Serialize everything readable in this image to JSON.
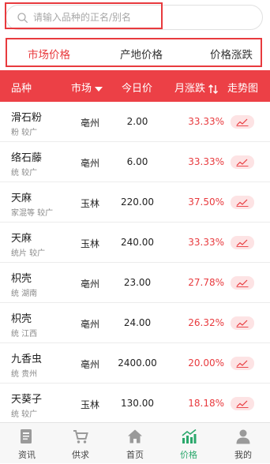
{
  "search": {
    "placeholder": "请输入品种的正名/别名"
  },
  "tabs": [
    {
      "label": "市场价格",
      "active": true
    },
    {
      "label": "产地价格",
      "active": false
    },
    {
      "label": "价格涨跌",
      "active": false
    }
  ],
  "table": {
    "headers": {
      "variety": "品种",
      "market": "市场",
      "price": "今日价",
      "change": "月涨跌",
      "trend": "走势图"
    },
    "rows": [
      {
        "name": "滑石粉",
        "spec": "粉 较广",
        "market": "亳州",
        "price": "2.00",
        "change": "33.33%"
      },
      {
        "name": "络石藤",
        "spec": "统 较广",
        "market": "亳州",
        "price": "6.00",
        "change": "33.33%"
      },
      {
        "name": "天麻",
        "spec": "家混等 较广",
        "market": "玉林",
        "price": "220.00",
        "change": "37.50%"
      },
      {
        "name": "天麻",
        "spec": "统片 较广",
        "market": "玉林",
        "price": "240.00",
        "change": "33.33%"
      },
      {
        "name": "枳壳",
        "spec": "统 湖南",
        "market": "亳州",
        "price": "23.00",
        "change": "27.78%"
      },
      {
        "name": "枳壳",
        "spec": "统 江西",
        "market": "亳州",
        "price": "24.00",
        "change": "26.32%"
      },
      {
        "name": "九香虫",
        "spec": "统 贵州",
        "market": "亳州",
        "price": "2400.00",
        "change": "20.00%"
      },
      {
        "name": "天葵子",
        "spec": "统 较广",
        "market": "玉林",
        "price": "130.00",
        "change": "18.18%"
      }
    ]
  },
  "nav": [
    {
      "label": "资讯",
      "icon": "news-icon",
      "active": false
    },
    {
      "label": "供求",
      "icon": "cart-icon",
      "active": false
    },
    {
      "label": "首页",
      "icon": "home-icon",
      "active": false
    },
    {
      "label": "价格",
      "icon": "chart-icon",
      "active": true
    },
    {
      "label": "我的",
      "icon": "user-icon",
      "active": false
    }
  ],
  "colors": {
    "accent": "#e83a3e",
    "header_bg": "#ec4046",
    "nav_active": "#2ba86c"
  }
}
